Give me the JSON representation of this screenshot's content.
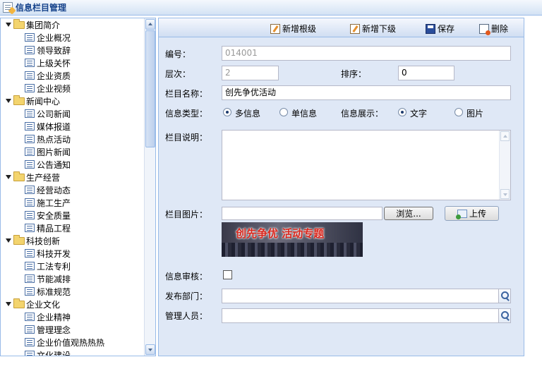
{
  "window": {
    "title": "信息栏目管理"
  },
  "tree": {
    "groups": [
      {
        "label": "集团简介",
        "children": [
          "企业概况",
          "领导致辞",
          "上级关怀",
          "企业资质",
          "企业视频"
        ]
      },
      {
        "label": "新闻中心",
        "children": [
          "公司新闻",
          "媒体报道",
          "热点活动",
          "图片新闻",
          "公告通知"
        ]
      },
      {
        "label": "生产经营",
        "children": [
          "经营动态",
          "施工生产",
          "安全质量",
          "精品工程"
        ]
      },
      {
        "label": "科技创新",
        "children": [
          "科技开发",
          "工法专利",
          "节能减排",
          "标准规范"
        ]
      },
      {
        "label": "企业文化",
        "children": [
          "企业精神",
          "管理理念",
          "企业价值观热热热",
          "文化建设"
        ]
      }
    ]
  },
  "toolbar": {
    "add_root": "新增根级",
    "add_child": "新增下级",
    "save": "保存",
    "delete": "删除"
  },
  "form": {
    "code_label": "编号：",
    "code_value": "014001",
    "level_label": "层次：",
    "level_value": "2",
    "order_label": "排序：",
    "order_value": "0",
    "name_label": "栏目名称：",
    "name_value": "创先争优活动",
    "type_label": "信息类型：",
    "type_multi": "多信息",
    "type_single": "单信息",
    "display_label": "信息展示：",
    "display_text": "文字",
    "display_image": "图片",
    "desc_label": "栏目说明：",
    "desc_value": "",
    "image_label": "栏目图片：",
    "image_path": "",
    "browse_label": "浏览...",
    "upload_label": "上传",
    "banner_text": "创先争优 活动专题",
    "audit_label": "信息审核：",
    "dept_label": "发布部门：",
    "dept_value": "",
    "manager_label": "管理人员：",
    "manager_value": ""
  }
}
